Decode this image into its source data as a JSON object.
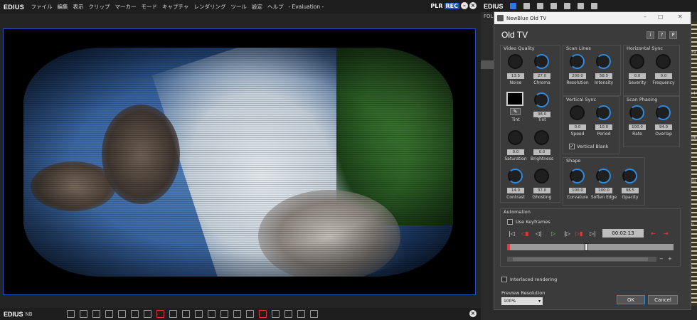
{
  "main": {
    "app_name": "EDIUS",
    "menu": [
      "ファイル",
      "編集",
      "表示",
      "クリップ",
      "マーカー",
      "モード",
      "キャプチャ",
      "レンダリング",
      "ツール",
      "設定",
      "ヘルプ",
      "- Evaluation -"
    ],
    "plr": "PLR",
    "rec": "REC",
    "bottom_app_name": "EDIUS",
    "bottom_tag": "NB"
  },
  "right_strip": {
    "app_name": "EDIUS",
    "folder_label": "FOL",
    "fragments": [
      "forFa",
      "me I",
      "otfile",
      "h BG",
      "hon Tit",
      "ton Gr"
    ]
  },
  "dialog": {
    "window_title": "NewBlue Old TV",
    "heading": "Old TV",
    "header_buttons": [
      "i",
      "?",
      "P"
    ],
    "video_quality": {
      "title": "Video Quality",
      "noise": {
        "label": "Noise",
        "value": "13.5"
      },
      "chroma": {
        "label": "Chroma",
        "value": "27.0"
      },
      "tint_color": {
        "label": "Tint"
      },
      "tint": {
        "label": "Tint",
        "value": "38.0"
      },
      "saturation": {
        "label": "Saturation",
        "value": "0.0"
      },
      "brightness": {
        "label": "Brightness",
        "value": "0.0"
      },
      "contrast": {
        "label": "Contrast",
        "value": "14.0"
      },
      "ghosting": {
        "label": "Ghosting",
        "value": "37.0"
      }
    },
    "scan_lines": {
      "title": "Scan Lines",
      "resolution": {
        "label": "Resolution",
        "value": "200.0"
      },
      "intensity": {
        "label": "Intensity",
        "value": "58.5"
      }
    },
    "horizontal_sync": {
      "title": "Horizontal Sync",
      "severity": {
        "label": "Severity",
        "value": "0.0"
      },
      "frequency": {
        "label": "Frequency",
        "value": "0.0"
      }
    },
    "vertical_sync": {
      "title": "Vertical Sync",
      "speed": {
        "label": "Speed",
        "value": "0.0"
      },
      "period": {
        "label": "Period",
        "value": "10.0"
      },
      "vertical_blank": "Vertical Blank"
    },
    "scan_phasing": {
      "title": "Scan Phasing",
      "rate": {
        "label": "Rate",
        "value": "100.0"
      },
      "overlap": {
        "label": "Overlap",
        "value": "94.0"
      }
    },
    "shape": {
      "title": "Shape",
      "curvature": {
        "label": "Curvature",
        "value": "100.0"
      },
      "soften_edge": {
        "label": "Soften Edge",
        "value": "100.0"
      },
      "opacity": {
        "label": "Opacity",
        "value": "98.5"
      }
    },
    "automation": {
      "title": "Automation",
      "use_keyframes": "Use Keyframes",
      "timecode": "00:02:13"
    },
    "interlaced_rendering": "Interlaced rendering",
    "preview_resolution_label": "Preview Resolution",
    "preview_resolution_value": "100%",
    "ok": "OK",
    "cancel": "Cancel"
  },
  "colors": {
    "accent_blue": "#2e8be0",
    "rec_blue": "#1a4fb5",
    "key_red": "#e23b3b",
    "play_green": "#6fd24a"
  }
}
